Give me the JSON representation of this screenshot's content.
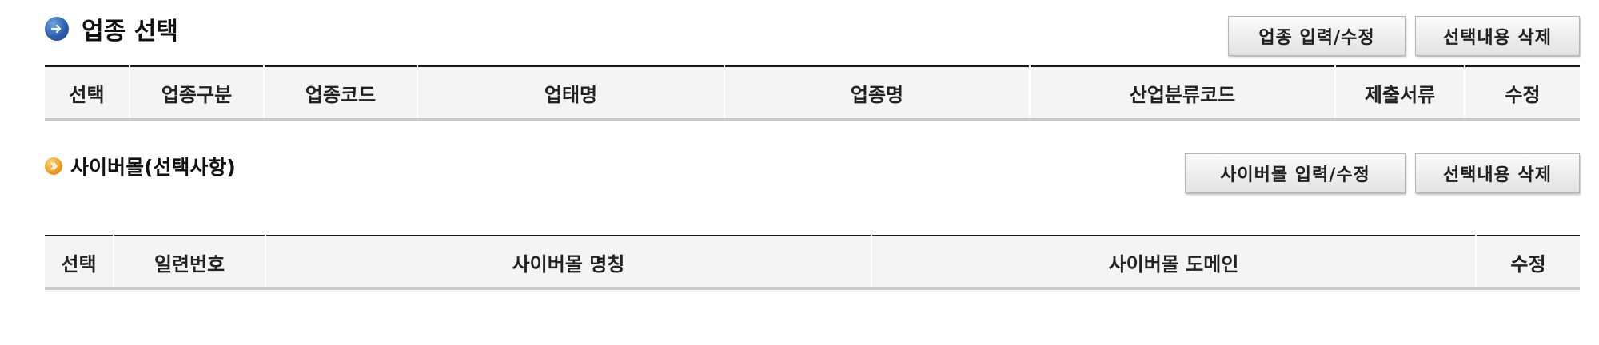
{
  "section1": {
    "title": "업종 선택",
    "buttons": {
      "edit": "업종 입력/수정",
      "delete": "선택내용 삭제"
    },
    "columns": [
      "선택",
      "업종구분",
      "업종코드",
      "업태명",
      "업종명",
      "산업분류코드",
      "제출서류",
      "수정"
    ]
  },
  "section2": {
    "title": "사이버몰(선택사항)",
    "buttons": {
      "edit": "사이버몰 입력/수정",
      "delete": "선택내용 삭제"
    },
    "columns": [
      "선택",
      "일련번호",
      "사이버몰 명칭",
      "사이버몰 도메인",
      "수정"
    ]
  },
  "icons": {
    "section1": "arrow-right-circle-icon",
    "section2": "chevron-right-circle-icon"
  },
  "colors": {
    "accent_blue": "#2a5fb0",
    "accent_orange": "#f0a023",
    "header_bg": "#f4f4f4"
  }
}
